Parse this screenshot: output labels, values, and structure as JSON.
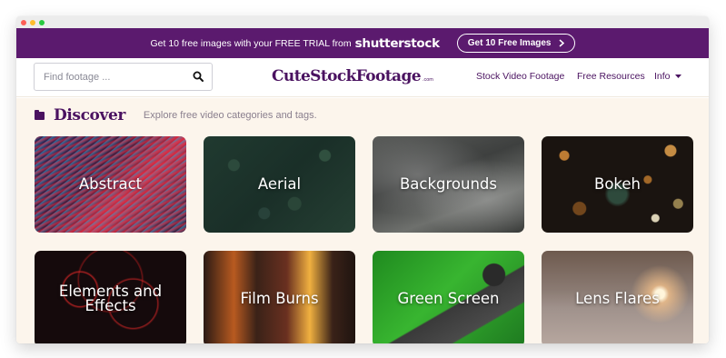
{
  "promo": {
    "text": "Get 10 free images with your FREE TRIAL from",
    "brand": "shutterstock",
    "button_label": "Get 10 Free Images"
  },
  "search": {
    "placeholder": "Find footage ..."
  },
  "logo": {
    "name": "CuteStockFootage",
    "suffix": ".com"
  },
  "nav": {
    "items": [
      {
        "label": "Stock Video Footage"
      },
      {
        "label": "Free Resources"
      },
      {
        "label": "Info"
      }
    ]
  },
  "discover": {
    "title": "Discover",
    "subtitle": "Explore free video categories and tags."
  },
  "categories": [
    {
      "label": "Abstract"
    },
    {
      "label": "Aerial"
    },
    {
      "label": "Backgrounds"
    },
    {
      "label": "Bokeh"
    },
    {
      "label": "Elements and Effects"
    },
    {
      "label": "Film Burns"
    },
    {
      "label": "Green Screen"
    },
    {
      "label": "Lens Flares"
    }
  ],
  "colors": {
    "brand_purple": "#5b1a6e",
    "text_purple": "#4a1260",
    "content_bg": "#fcf5ec"
  },
  "icons": [
    "close-dot-icon",
    "minimize-dot-icon",
    "maximize-dot-icon",
    "search-icon",
    "chevron-right-icon",
    "caret-down-icon",
    "folder-icon"
  ]
}
